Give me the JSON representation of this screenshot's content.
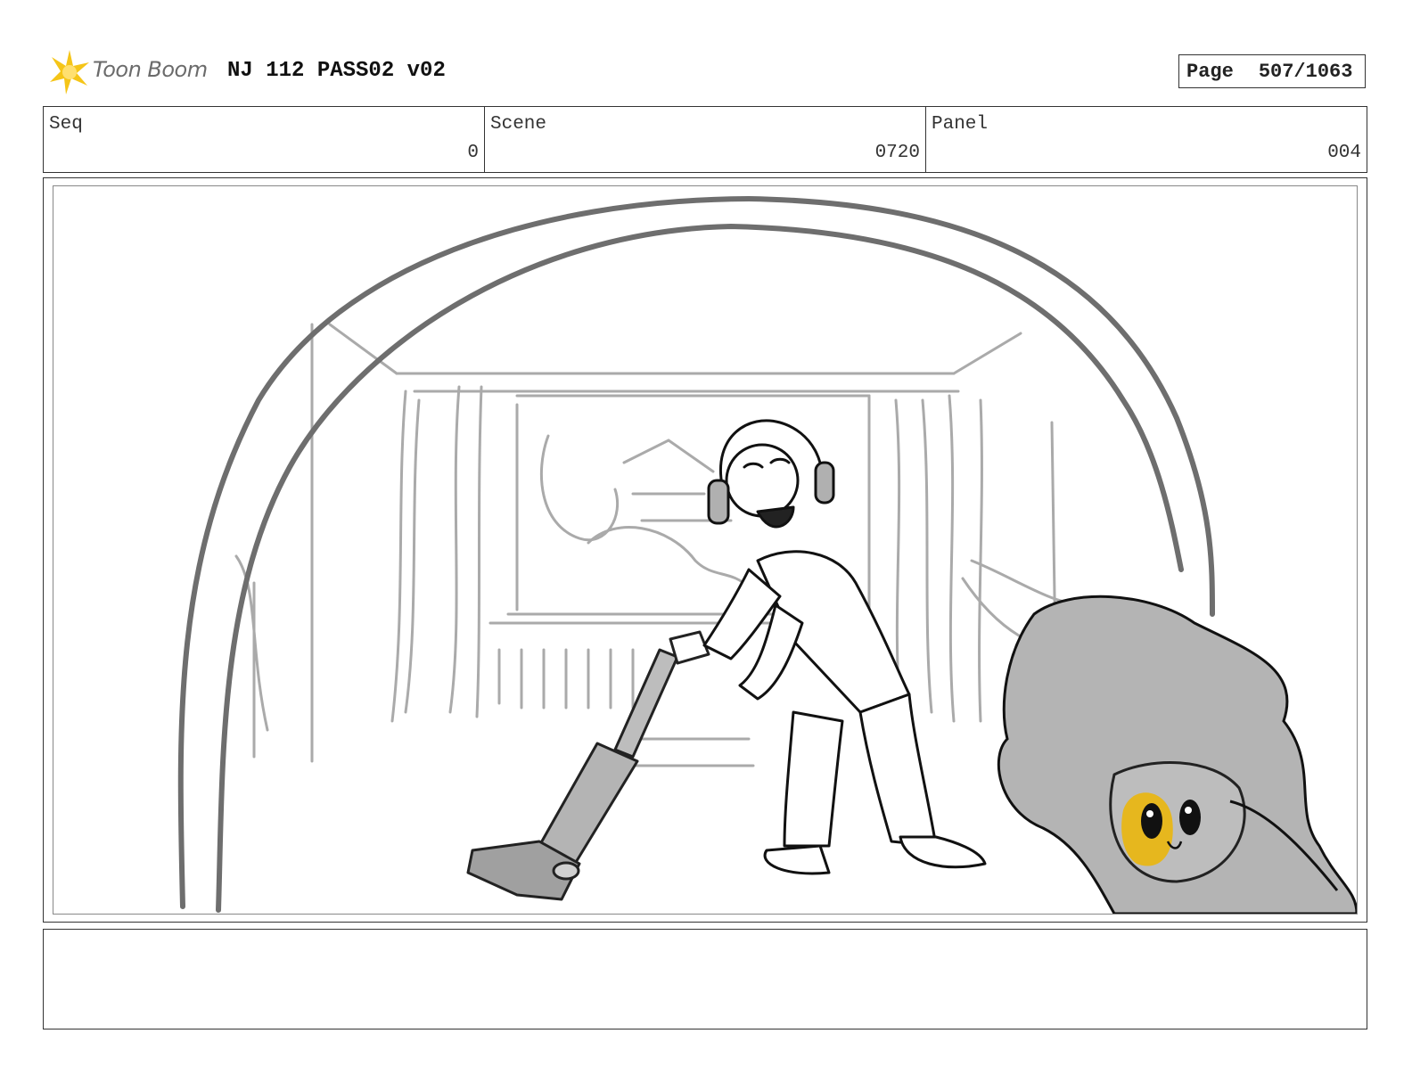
{
  "header": {
    "logo_text": "Toon Boom",
    "title": "NJ 112 PASS02 v02",
    "page_label": "Page",
    "page_value": "507/1063"
  },
  "info": {
    "seq_label": "Seq",
    "seq_value": "0",
    "scene_label": "Scene",
    "scene_value": "0720",
    "panel_label": "Panel",
    "panel_value": "004"
  },
  "notes": {
    "text": ""
  },
  "colors": {
    "logo_star": "#f5c518",
    "frame_border": "#333333",
    "sketch_gray": "#aaaaaa",
    "tone_gray": "#b4b4b4",
    "highlight_yellow": "#e6b71e"
  }
}
